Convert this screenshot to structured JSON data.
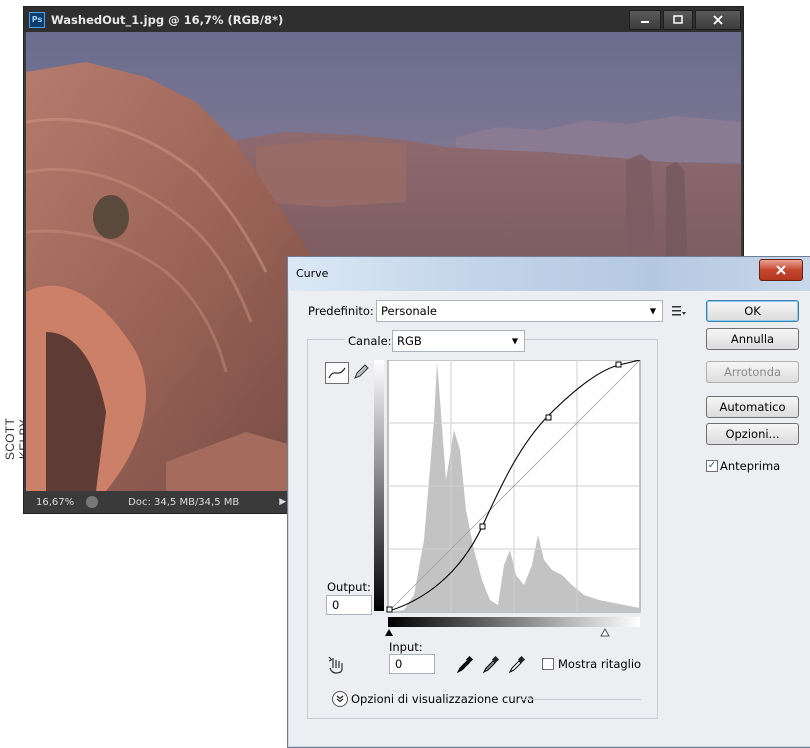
{
  "credit": "SCOTT KELBY",
  "document": {
    "title": "WashedOut_1.jpg @ 16,7% (RGB/8*)",
    "app_icon": "Ps",
    "zoom": "16,67%",
    "doc_info": "Doc: 34,5 MB/34,5 MB"
  },
  "dialog": {
    "title": "Curve",
    "close": "x",
    "preset_label": "Predefinito:",
    "preset_value": "Personale",
    "channel_label": "Canale:",
    "channel_value": "RGB",
    "output_label": "Output:",
    "output_value": "0",
    "input_label": "Input:",
    "input_value": "0",
    "show_clipping_label": "Mostra ritaglio",
    "curve_options_label": "Opzioni di visualizzazione curva",
    "buttons": {
      "ok": "OK",
      "cancel": "Annulla",
      "smooth": "Arrotonda",
      "auto": "Automatico",
      "options": "Opzioni..."
    },
    "preview_label": "Anteprima",
    "preview_checked": true
  }
}
